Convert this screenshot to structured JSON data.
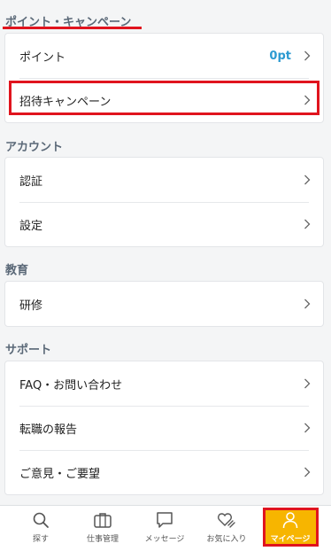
{
  "sections": {
    "points": {
      "title": "ポイント・キャンペーン",
      "rows": [
        {
          "label": "ポイント",
          "value": "0pt"
        },
        {
          "label": "招待キャンペーン"
        }
      ]
    },
    "account": {
      "title": "アカウント",
      "rows": [
        {
          "label": "認証"
        },
        {
          "label": "設定"
        }
      ]
    },
    "education": {
      "title": "教育",
      "rows": [
        {
          "label": "研修"
        }
      ]
    },
    "support": {
      "title": "サポート",
      "rows": [
        {
          "label": "FAQ・お問い合わせ"
        },
        {
          "label": "転職の報告"
        },
        {
          "label": "ご意見・ご要望"
        }
      ]
    }
  },
  "tabbar": {
    "tabs": [
      {
        "label": "探す",
        "icon": "search-icon"
      },
      {
        "label": "仕事管理",
        "icon": "briefcase-icon"
      },
      {
        "label": "メッセージ",
        "icon": "message-icon"
      },
      {
        "label": "お気に入り",
        "icon": "heart-icon"
      },
      {
        "label": "マイページ",
        "icon": "person-icon",
        "active": true
      }
    ]
  },
  "colors": {
    "accent_blue": "#2c9ad1",
    "highlight_red": "#e0141e",
    "active_tab_bg": "#f7b500"
  }
}
